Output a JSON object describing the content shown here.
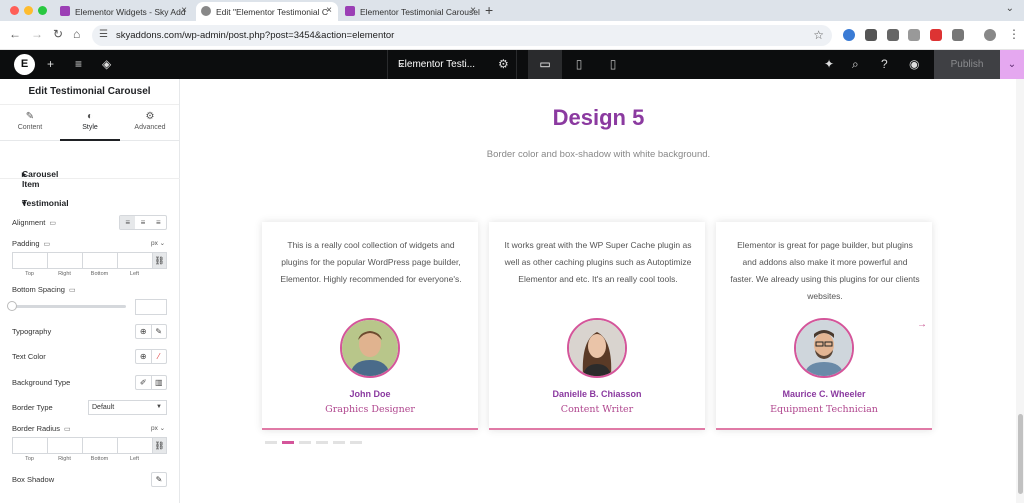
{
  "browser": {
    "tabs": [
      {
        "title": "Elementor Widgets - Sky Add",
        "favicon_color": "#9b3fb5"
      },
      {
        "title": "Edit \"Elementor Testimonial C",
        "favicon_color": "#666666"
      },
      {
        "title": "Elementor Testimonial Carousel",
        "favicon_color": "#9b3fb5"
      }
    ],
    "url": "skyaddons.com/wp-admin/post.php?post=3454&action=elementor"
  },
  "editor": {
    "doc_title": "Elementor Testi...",
    "publish_label": "Publish"
  },
  "panel": {
    "title": "Edit Testimonial Carousel",
    "tabs": [
      {
        "label": "Content",
        "icon": "pencil-icon"
      },
      {
        "label": "Style",
        "icon": "half-circle-icon"
      },
      {
        "label": "Advanced",
        "icon": "gear-icon"
      }
    ],
    "sections": {
      "carousel_item": "Carousel Item",
      "testimonial": "Testimonial"
    },
    "controls": {
      "alignment": "Alignment",
      "padding": "Padding",
      "bottom_spacing": "Bottom Spacing",
      "typography": "Typography",
      "text_color": "Text Color",
      "background_type": "Background Type",
      "border_type": "Border Type",
      "border_type_value": "Default",
      "border_radius": "Border Radius",
      "box_shadow": "Box Shadow",
      "unit": "px",
      "dims": [
        "Top",
        "Right",
        "Bottom",
        "Left"
      ]
    }
  },
  "page": {
    "heading": "Design 5",
    "subheading": "Border color and box-shadow with white background.",
    "testimonials": [
      {
        "quote": "This is a really cool collection of widgets and plugins for the popular WordPress page builder, Elementor. Highly recommended for everyone's.",
        "name": "John Doe",
        "role": "Graphics Designer"
      },
      {
        "quote": "It works great with the WP Super Cache plugin as well as other caching plugins such as Autoptimize Elementor and etc. It's an really cool tools.",
        "name": "Danielle B. Chiasson",
        "role": "Content Writer"
      },
      {
        "quote": "Elementor is great for page builder, but plugins and addons also make it more powerful and faster. We already using this plugins for our clients websites.",
        "name": "Maurice C. Wheeler",
        "role": "Equipment Technician"
      }
    ],
    "active_dot": 1,
    "dot_count": 6
  },
  "colors": {
    "accent": "#8b3aa0",
    "pink": "#d4559a"
  }
}
